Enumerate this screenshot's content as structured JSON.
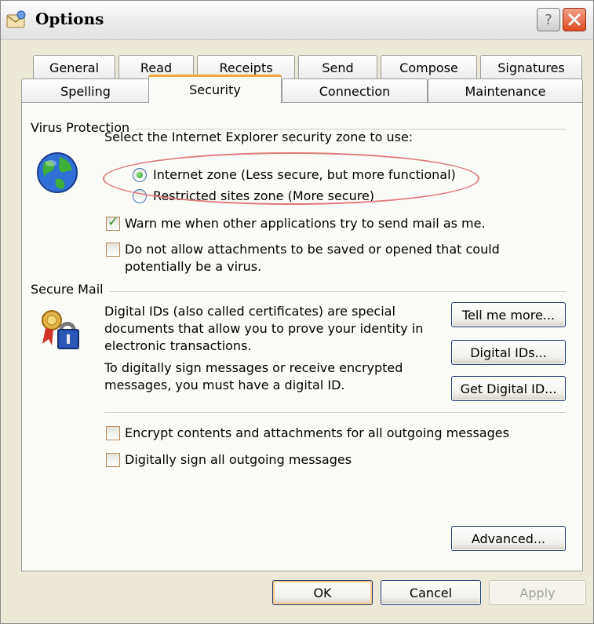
{
  "window": {
    "title": "Options",
    "help_glyph": "?",
    "icon": "options-envelope-icon"
  },
  "tabs": {
    "row1": [
      "General",
      "Read",
      "Receipts",
      "Send",
      "Compose",
      "Signatures"
    ],
    "row2": [
      "Spelling",
      "Security",
      "Connection",
      "Maintenance"
    ],
    "active": "Security"
  },
  "virus_protection": {
    "title": "Virus Protection",
    "icon": "globe-icon",
    "zone_prompt": "Select the Internet Explorer security zone to use:",
    "zones": [
      {
        "label": "Internet zone (Less secure, but more functional)",
        "selected": true
      },
      {
        "label": "Restricted sites zone (More secure)",
        "selected": false
      }
    ],
    "warn_label": "Warn me when other applications try to send mail as me.",
    "warn_checked": true,
    "block_attachments_line1": "Do not allow attachments to be saved or opened that could",
    "block_attachments_line2": "potentially be a virus.",
    "block_attachments_checked": false
  },
  "secure_mail": {
    "title": "Secure Mail",
    "icon": "certificate-lock-icon",
    "desc1_line1": "Digital IDs (also called certificates) are special",
    "desc1_line2": "documents that allow you to prove your identity in",
    "desc1_line3": "electronic transactions.",
    "desc2_line1": "To digitally sign messages or receive encrypted",
    "desc2_line2": "messages, you must have a digital ID.",
    "tell_me_more": "Tell me more...",
    "digital_ids": "Digital IDs...",
    "get_digital_id": "Get Digital ID...",
    "encrypt_label": "Encrypt contents and attachments for all outgoing messages",
    "encrypt_checked": false,
    "sign_label": "Digitally sign all outgoing messages",
    "sign_checked": false,
    "advanced": "Advanced..."
  },
  "footer": {
    "ok": "OK",
    "cancel": "Cancel",
    "apply": "Apply"
  },
  "colors": {
    "dialog_bg": "#ece9d8",
    "panel_bg": "#fbfbf8",
    "active_tab_accent": "#f3a83b",
    "annotation": "#e07a7a"
  }
}
